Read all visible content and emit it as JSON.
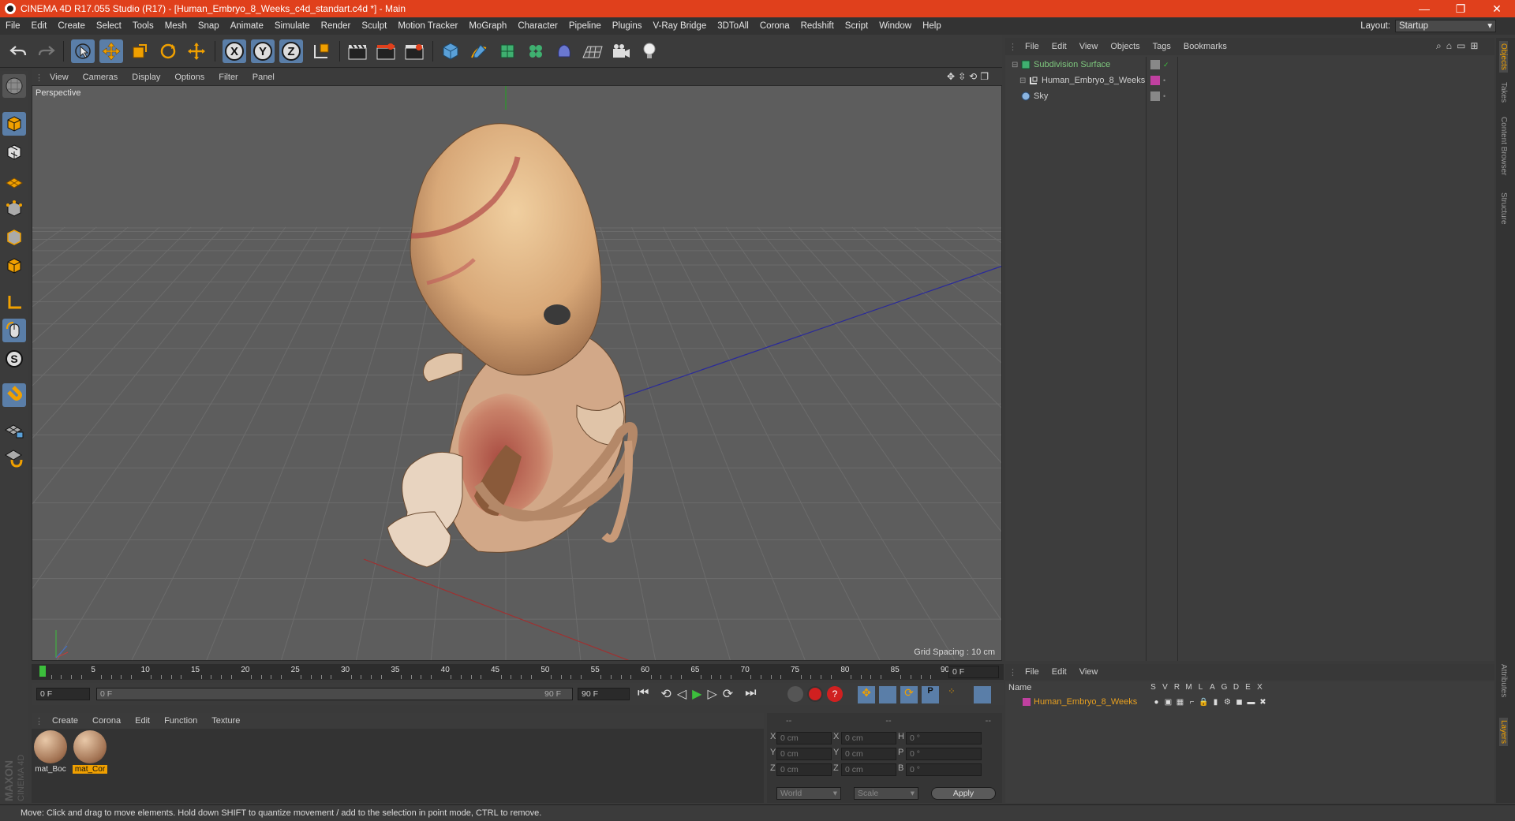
{
  "window": {
    "title": "CINEMA 4D R17.055 Studio (R17) - [Human_Embryo_8_Weeks_c4d_standart.c4d *] - Main",
    "minimize": "—",
    "restore": "❐",
    "close": "✕"
  },
  "menubar": [
    "File",
    "Edit",
    "Create",
    "Select",
    "Tools",
    "Mesh",
    "Snap",
    "Animate",
    "Simulate",
    "Render",
    "Sculpt",
    "Motion Tracker",
    "MoGraph",
    "Character",
    "Pipeline",
    "Plugins",
    "V-Ray Bridge",
    "3DToAll",
    "Corona",
    "Redshift",
    "Script",
    "Window",
    "Help"
  ],
  "layout": {
    "label": "Layout:",
    "value": "Startup"
  },
  "toolbar": {
    "axis_x": "X",
    "axis_y": "Y",
    "axis_z": "Z"
  },
  "viewport": {
    "menu": [
      "View",
      "Cameras",
      "Display",
      "Options",
      "Filter",
      "Panel"
    ],
    "label": "Perspective",
    "grid_spacing": "Grid Spacing : 10 cm"
  },
  "timeline": {
    "ticks": [
      "0",
      "5",
      "10",
      "15",
      "20",
      "25",
      "30",
      "35",
      "40",
      "45",
      "50",
      "55",
      "60",
      "65",
      "70",
      "75",
      "80",
      "85",
      "90"
    ],
    "current_frame": "0 F",
    "start_field": "0 F",
    "range_start": "0 F",
    "range_end": "90 F",
    "end_field": "90 F"
  },
  "material_manager": {
    "menu": [
      "Create",
      "Corona",
      "Edit",
      "Function",
      "Texture"
    ],
    "materials": [
      {
        "name": "mat_Boc",
        "selected": false
      },
      {
        "name": "mat_Cor",
        "selected": true
      }
    ]
  },
  "coordinates": {
    "headers": [
      "--",
      "--",
      "--"
    ],
    "rows": [
      {
        "a": "X",
        "av": "0 cm",
        "b": "X",
        "bv": "0 cm",
        "c": "H",
        "cv": "0 °"
      },
      {
        "a": "Y",
        "av": "0 cm",
        "b": "Y",
        "bv": "0 cm",
        "c": "P",
        "cv": "0 °"
      },
      {
        "a": "Z",
        "av": "0 cm",
        "b": "Z",
        "bv": "0 cm",
        "c": "B",
        "cv": "0 °"
      }
    ],
    "space": "World",
    "mode": "Scale",
    "apply": "Apply"
  },
  "object_manager": {
    "menu": [
      "File",
      "Edit",
      "View",
      "Objects",
      "Tags",
      "Bookmarks"
    ],
    "objects": [
      {
        "name": "Subdivision Surface",
        "color": "#7ec87e"
      },
      {
        "name": "Human_Embryo_8_Weeks",
        "color": "#cfcfcf"
      },
      {
        "name": "Sky",
        "color": "#cfcfcf"
      }
    ]
  },
  "layer_manager": {
    "menu": [
      "File",
      "Edit",
      "View"
    ],
    "header": {
      "name": "Name",
      "cols": [
        "S",
        "V",
        "R",
        "M",
        "L",
        "A",
        "G",
        "D",
        "E",
        "X"
      ]
    },
    "layers": [
      {
        "name": "Human_Embryo_8_Weeks",
        "color": "#e8a020"
      }
    ]
  },
  "right_tabs": [
    "Objects",
    "Takes",
    "Content Browser",
    "Structure",
    "Attributes",
    "Layers"
  ],
  "brand": {
    "maxon": "MAXON",
    "product": "CINEMA 4D"
  },
  "status": "Move: Click and drag to move elements. Hold down SHIFT to quantize movement / add to the selection in point mode, CTRL to remove."
}
